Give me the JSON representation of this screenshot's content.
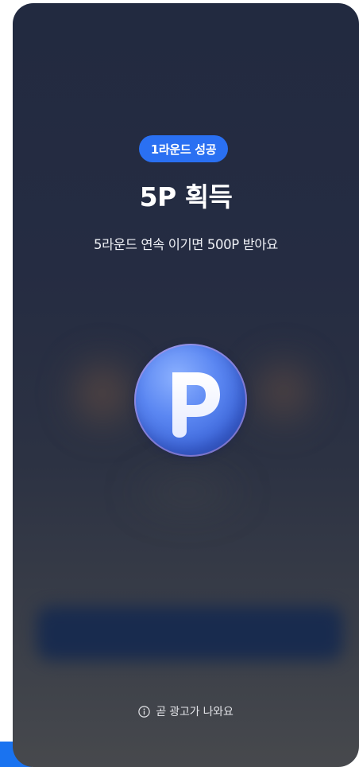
{
  "badge": {
    "label": "1라운드 성공"
  },
  "reward": {
    "title": "5P 획득",
    "subtitle": "5라운드 연속 이기면 500P 받아요"
  },
  "coin": {
    "icon": "point-coin-icon",
    "letter": "P"
  },
  "notice": {
    "icon": "info-icon",
    "text": "곧 광고가 나와요"
  },
  "colors": {
    "badge_background": "#2a70f2",
    "card_top": "#222a40",
    "card_bottom": "#47494d",
    "coin": "#5b87f2",
    "accent": "#1a73f0"
  }
}
